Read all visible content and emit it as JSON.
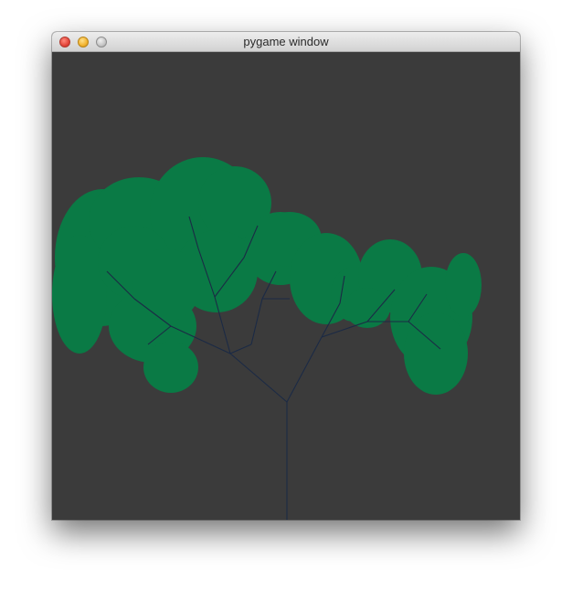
{
  "window": {
    "title": "pygame window"
  },
  "canvas": {
    "background_color": "#3b3b3b",
    "branch_color": "#1b2a45",
    "leaf_color": "#0a7a45",
    "content": "fractal-tree"
  }
}
